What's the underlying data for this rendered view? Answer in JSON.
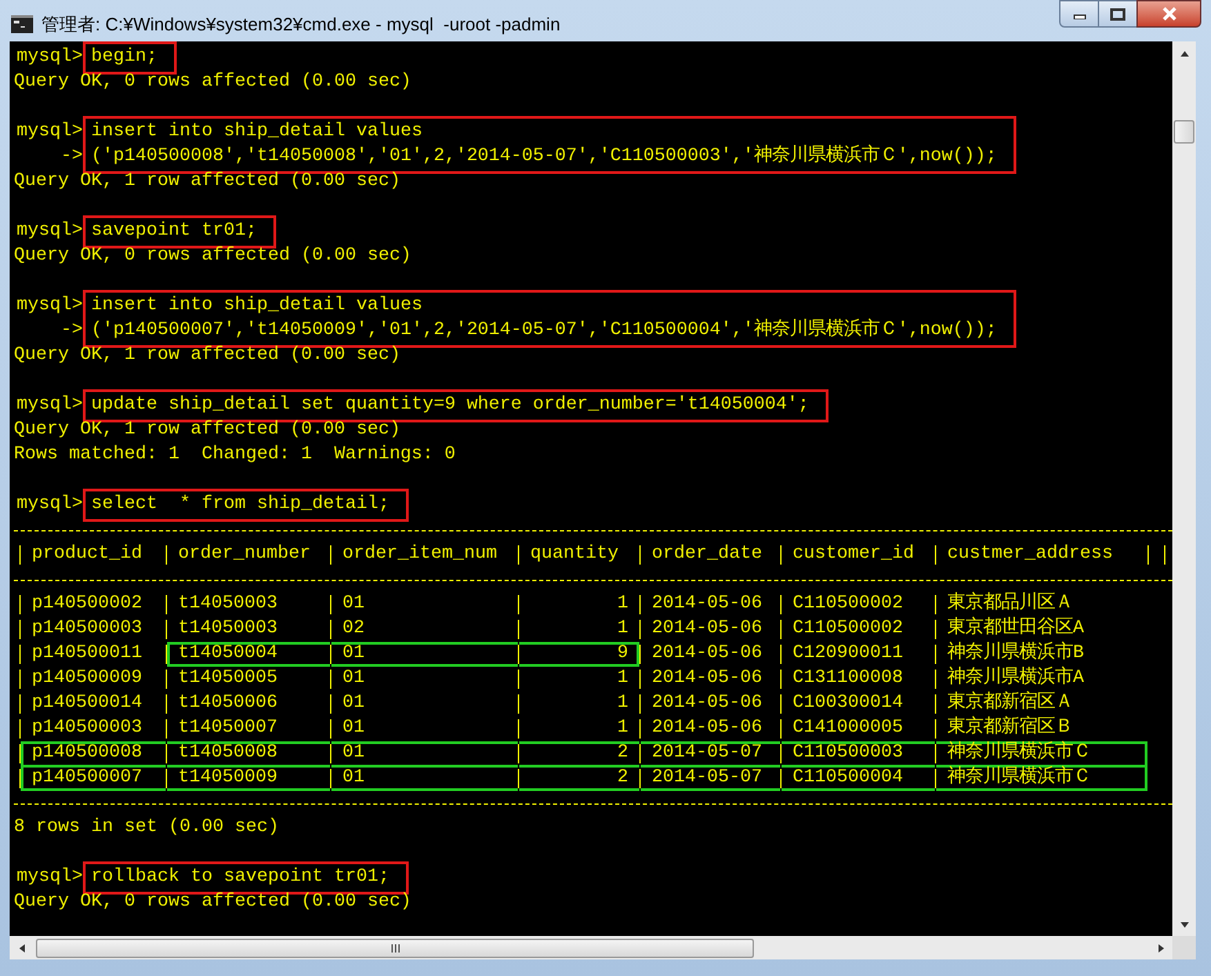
{
  "window": {
    "title": "管理者: C:¥Windows¥system32¥cmd.exe - mysql  -uroot -padmin"
  },
  "console": {
    "blocks": [
      {
        "kind": "command",
        "highlighted": true,
        "lines": [
          {
            "prompt": "mysql>",
            "text": "begin;"
          }
        ]
      },
      {
        "kind": "output",
        "lines": [
          "Query OK, 0 rows affected (0.00 sec)"
        ]
      },
      {
        "kind": "blank"
      },
      {
        "kind": "command",
        "highlighted": true,
        "lines": [
          {
            "prompt": "mysql>",
            "text": "insert into ship_detail values"
          },
          {
            "prompt": "->",
            "text": "('p140500008','t14050008','01',2,'2014-05-07','C110500003','神奈川県横浜市Ｃ',now());"
          }
        ]
      },
      {
        "kind": "output",
        "lines": [
          "Query OK, 1 row affected (0.00 sec)"
        ]
      },
      {
        "kind": "blank"
      },
      {
        "kind": "command",
        "highlighted": true,
        "lines": [
          {
            "prompt": "mysql>",
            "text": "savepoint tr01;"
          }
        ]
      },
      {
        "kind": "output",
        "lines": [
          "Query OK, 0 rows affected (0.00 sec)"
        ]
      },
      {
        "kind": "blank"
      },
      {
        "kind": "command",
        "highlighted": true,
        "lines": [
          {
            "prompt": "mysql>",
            "text": "insert into ship_detail values"
          },
          {
            "prompt": "->",
            "text": "('p140500007','t14050009','01',2,'2014-05-07','C110500004','神奈川県横浜市Ｃ',now());"
          }
        ]
      },
      {
        "kind": "output",
        "lines": [
          "Query OK, 1 row affected (0.00 sec)"
        ]
      },
      {
        "kind": "blank"
      },
      {
        "kind": "command",
        "highlighted": true,
        "lines": [
          {
            "prompt": "mysql>",
            "text": "update ship_detail set quantity=9 where order_number='t14050004';"
          }
        ]
      },
      {
        "kind": "output",
        "lines": [
          "Query OK, 1 row affected (0.00 sec)",
          "Rows matched: 1  Changed: 1  Warnings: 0"
        ]
      },
      {
        "kind": "blank"
      },
      {
        "kind": "command",
        "highlighted": true,
        "lines": [
          {
            "prompt": "mysql>",
            "text": "select  * from ship_detail;"
          }
        ]
      },
      {
        "kind": "table",
        "columns": [
          {
            "label": "product_id",
            "numeric": false
          },
          {
            "label": "order_number",
            "numeric": false
          },
          {
            "label": "order_item_num",
            "numeric": false
          },
          {
            "label": "quantity",
            "numeric": true
          },
          {
            "label": "order_date",
            "numeric": false
          },
          {
            "label": "customer_id",
            "numeric": false
          },
          {
            "label": "custmer_address",
            "numeric": false
          }
        ],
        "rows": [
          {
            "cells": [
              {
                "text": "p140500002",
                "highlighted": false
              },
              {
                "text": "t14050003",
                "highlighted": false
              },
              {
                "text": "01",
                "highlighted": false
              },
              {
                "text": "1",
                "highlighted": false
              },
              {
                "text": "2014-05-06",
                "highlighted": false
              },
              {
                "text": "C110500002",
                "highlighted": false
              },
              {
                "text": "東京都品川区Ａ",
                "highlighted": false
              }
            ]
          },
          {
            "cells": [
              {
                "text": "p140500003",
                "highlighted": false
              },
              {
                "text": "t14050003",
                "highlighted": false
              },
              {
                "text": "02",
                "highlighted": false
              },
              {
                "text": "1",
                "highlighted": false
              },
              {
                "text": "2014-05-06",
                "highlighted": false
              },
              {
                "text": "C110500002",
                "highlighted": false
              },
              {
                "text": "東京都世田谷区A",
                "highlighted": false
              }
            ]
          },
          {
            "cells": [
              {
                "text": "p140500011",
                "highlighted": false
              },
              {
                "text": "t14050004",
                "highlighted": true
              },
              {
                "text": "01",
                "highlighted": true
              },
              {
                "text": "9",
                "highlighted": true
              },
              {
                "text": "2014-05-06",
                "highlighted": false
              },
              {
                "text": "C120900011",
                "highlighted": false
              },
              {
                "text": "神奈川県横浜市B",
                "highlighted": false
              }
            ]
          },
          {
            "cells": [
              {
                "text": "p140500009",
                "highlighted": false
              },
              {
                "text": "t14050005",
                "highlighted": false
              },
              {
                "text": "01",
                "highlighted": false
              },
              {
                "text": "1",
                "highlighted": false
              },
              {
                "text": "2014-05-06",
                "highlighted": false
              },
              {
                "text": "C131100008",
                "highlighted": false
              },
              {
                "text": "神奈川県横浜市A",
                "highlighted": false
              }
            ]
          },
          {
            "cells": [
              {
                "text": "p140500014",
                "highlighted": false
              },
              {
                "text": "t14050006",
                "highlighted": false
              },
              {
                "text": "01",
                "highlighted": false
              },
              {
                "text": "1",
                "highlighted": false
              },
              {
                "text": "2014-05-06",
                "highlighted": false
              },
              {
                "text": "C100300014",
                "highlighted": false
              },
              {
                "text": "東京都新宿区Ａ",
                "highlighted": false
              }
            ]
          },
          {
            "cells": [
              {
                "text": "p140500003",
                "highlighted": false
              },
              {
                "text": "t14050007",
                "highlighted": false
              },
              {
                "text": "01",
                "highlighted": false
              },
              {
                "text": "1",
                "highlighted": false
              },
              {
                "text": "2014-05-06",
                "highlighted": false
              },
              {
                "text": "C141000005",
                "highlighted": false
              },
              {
                "text": "東京都新宿区Ｂ",
                "highlighted": false
              }
            ]
          },
          {
            "cells": [
              {
                "text": "p140500008",
                "highlighted": true
              },
              {
                "text": "t14050008",
                "highlighted": true
              },
              {
                "text": "01",
                "highlighted": true
              },
              {
                "text": "2",
                "highlighted": true
              },
              {
                "text": "2014-05-07",
                "highlighted": true
              },
              {
                "text": "C110500003",
                "highlighted": true
              },
              {
                "text": "神奈川県横浜市Ｃ",
                "highlighted": true
              }
            ]
          },
          {
            "cells": [
              {
                "text": "p140500007",
                "highlighted": true
              },
              {
                "text": "t14050009",
                "highlighted": true
              },
              {
                "text": "01",
                "highlighted": true
              },
              {
                "text": "2",
                "highlighted": true
              },
              {
                "text": "2014-05-07",
                "highlighted": true
              },
              {
                "text": "C110500004",
                "highlighted": true
              },
              {
                "text": "神奈川県横浜市Ｃ",
                "highlighted": true
              }
            ]
          }
        ]
      },
      {
        "kind": "output",
        "lines": [
          "8 rows in set (0.00 sec)"
        ]
      },
      {
        "kind": "blank"
      },
      {
        "kind": "command",
        "highlighted": true,
        "lines": [
          {
            "prompt": "mysql>",
            "text": "rollback to savepoint tr01;"
          }
        ]
      },
      {
        "kind": "output",
        "lines": [
          "Query OK, 0 rows affected (0.00 sec)"
        ]
      }
    ]
  }
}
